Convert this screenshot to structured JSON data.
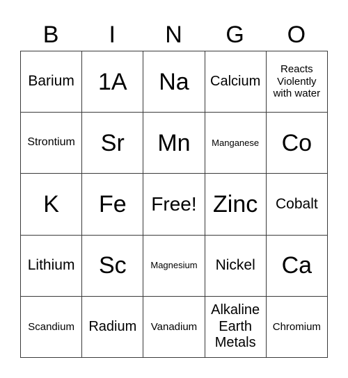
{
  "header": [
    "B",
    "I",
    "N",
    "G",
    "O"
  ],
  "cells": [
    [
      "Barium",
      "1A",
      "Na",
      "Calcium",
      "Reacts Violently with water"
    ],
    [
      "Strontium",
      "Sr",
      "Mn",
      "Manganese",
      "Co"
    ],
    [
      "K",
      "Fe",
      "Free!",
      "Zinc",
      "Cobalt"
    ],
    [
      "Lithium",
      "Sc",
      "Magnesium",
      "Nickel",
      "Ca"
    ],
    [
      "Scandium",
      "Radium",
      "Vanadium",
      "Alkaline Earth Metals",
      "Chromium"
    ]
  ]
}
